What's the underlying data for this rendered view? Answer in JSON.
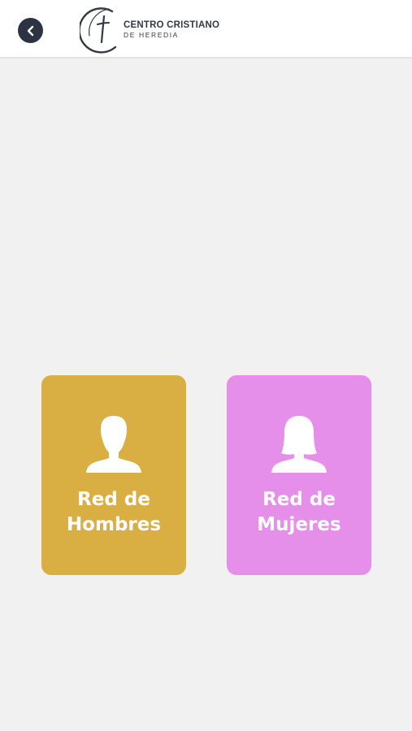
{
  "header": {
    "back_icon": "chevron-left-icon",
    "logo": {
      "line1": "CENTRO CRISTIANO",
      "line2": "DE HEREDIA",
      "icon": "cross-circle-logo-icon"
    }
  },
  "cards": [
    {
      "label_line1": "Red de",
      "label_line2": "Hombres",
      "icon": "man-silhouette-icon",
      "color": "#d9ae43"
    },
    {
      "label_line1": "Red de",
      "label_line2": "Mujeres",
      "icon": "woman-silhouette-icon",
      "color": "#e68fea"
    }
  ],
  "colors": {
    "background": "#f1f1f1",
    "header": "#ffffff",
    "back_button": "#2b3440"
  }
}
